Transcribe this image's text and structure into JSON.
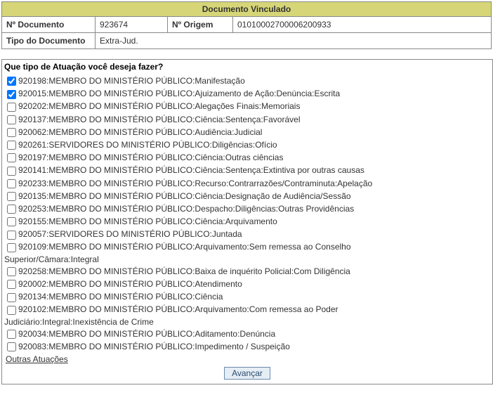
{
  "docHeader": {
    "title": "Documento Vinculado",
    "labelNumero": "Nº Documento",
    "numero": "923674",
    "labelOrigem": "Nº Origem",
    "origem": "01010002700006200933",
    "labelTipo": "Tipo do Documento",
    "tipo": "Extra-Jud."
  },
  "question": "Que tipo de Atuação você deseja fazer?",
  "items": [
    {
      "checked": true,
      "label": "920198:MEMBRO DO MINISTÉRIO PÚBLICO:Manifestação"
    },
    {
      "checked": true,
      "label": "920015:MEMBRO DO MINISTÉRIO PÚBLICO:Ajuizamento de Ação:Denúncia:Escrita"
    },
    {
      "checked": false,
      "label": "920202:MEMBRO DO MINISTÉRIO PÚBLICO:Alegações Finais:Memoriais"
    },
    {
      "checked": false,
      "label": "920137:MEMBRO DO MINISTÉRIO PÚBLICO:Ciência:Sentença:Favorável"
    },
    {
      "checked": false,
      "label": "920062:MEMBRO DO MINISTÉRIO PÚBLICO:Audiência:Judicial"
    },
    {
      "checked": false,
      "label": "920261:SERVIDORES DO MINISTÉRIO PÚBLICO:Diligências:Ofício"
    },
    {
      "checked": false,
      "label": "920197:MEMBRO DO MINISTÉRIO PÚBLICO:Ciência:Outras ciências"
    },
    {
      "checked": false,
      "label": "920141:MEMBRO DO MINISTÉRIO PÚBLICO:Ciência:Sentença:Extintiva por outras causas"
    },
    {
      "checked": false,
      "label": "920233:MEMBRO DO MINISTÉRIO PÚBLICO:Recurso:Contrarrazões/Contraminuta:Apelação"
    },
    {
      "checked": false,
      "label": "920135:MEMBRO DO MINISTÉRIO PÚBLICO:Ciência:Designação de Audiência/Sessão"
    },
    {
      "checked": false,
      "label": "920253:MEMBRO DO MINISTÉRIO PÚBLICO:Despacho:Diligências:Outras Providências"
    },
    {
      "checked": false,
      "label": "920155:MEMBRO DO MINISTÉRIO PÚBLICO:Ciência:Arquivamento"
    },
    {
      "checked": false,
      "label": "920057:SERVIDORES DO MINISTÉRIO PÚBLICO:Juntada"
    },
    {
      "checked": false,
      "label": "920109:MEMBRO DO MINISTÉRIO PÚBLICO:Arquivamento:Sem remessa ao Conselho",
      "wrap": "Superior/Câmara:Integral"
    },
    {
      "checked": false,
      "label": "920258:MEMBRO DO MINISTÉRIO PÚBLICO:Baixa de inquérito Policial:Com Diligência"
    },
    {
      "checked": false,
      "label": "920002:MEMBRO DO MINISTÉRIO PÚBLICO:Atendimento"
    },
    {
      "checked": false,
      "label": "920134:MEMBRO DO MINISTÉRIO PÚBLICO:Ciência"
    },
    {
      "checked": false,
      "label": "920102:MEMBRO DO MINISTÉRIO PÚBLICO:Arquivamento:Com remessa ao Poder",
      "wrap": "Judiciário:Integral:Inexistência de Crime"
    },
    {
      "checked": false,
      "label": "920034:MEMBRO DO MINISTÉRIO PÚBLICO:Aditamento:Denúncia"
    },
    {
      "checked": false,
      "label": "920083:MEMBRO DO MINISTÉRIO PÚBLICO:Impedimento / Suspeição"
    }
  ],
  "otherLink": "Outras Atuações",
  "advanceButton": "Avançar"
}
